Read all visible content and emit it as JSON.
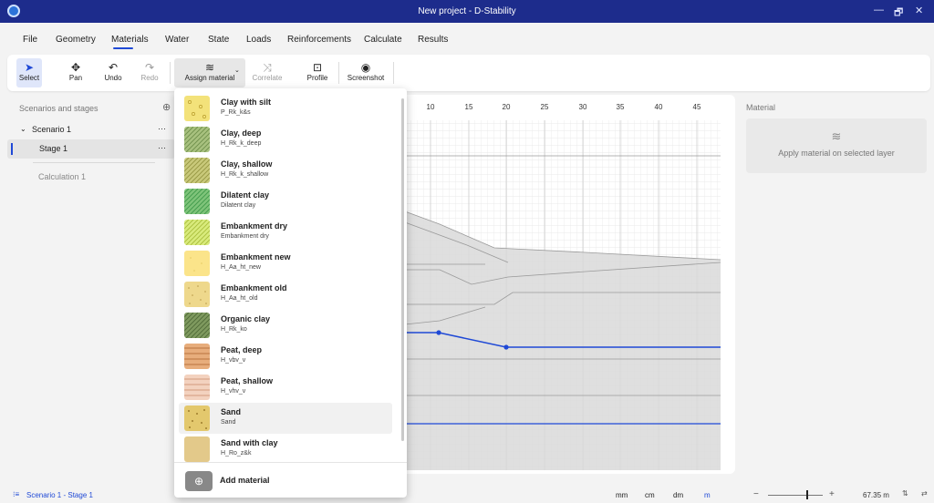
{
  "window": {
    "title": "New project - D-Stability",
    "controls": [
      "—",
      "🗗",
      "✕"
    ]
  },
  "menu": [
    {
      "label": "File"
    },
    {
      "label": "Geometry"
    },
    {
      "label": "Materials"
    },
    {
      "label": "Water"
    },
    {
      "label": "State"
    },
    {
      "label": "Loads"
    },
    {
      "label": "Reinforcements"
    },
    {
      "label": "Calculate"
    },
    {
      "label": "Results"
    }
  ],
  "ribbon": {
    "select": "Select",
    "pan": "Pan",
    "undo": "Undo",
    "redo": "Redo",
    "assign_material": "Assign material",
    "correlate": "Correlate",
    "profile": "Profile",
    "screenshot": "Screenshot"
  },
  "left_panel": {
    "header": "Scenarios and stages",
    "scenario": "Scenario 1",
    "stage": "Stage 1",
    "calculation": "Calculation 1",
    "more": "···"
  },
  "ruler": {
    "ticks": [
      "10",
      "15",
      "20",
      "25",
      "30",
      "35",
      "40",
      "45"
    ]
  },
  "right_panel": {
    "header": "Material",
    "hint": "Apply material on selected layer"
  },
  "material_menu": {
    "items": [
      {
        "name": "Clay with silt",
        "code": "P_Rk_k&s",
        "pattern": "silt"
      },
      {
        "name": "Clay, deep",
        "code": "H_Rk_k_deep",
        "pattern": "diag-green"
      },
      {
        "name": "Clay, shallow",
        "code": "H_Rk_k_shallow",
        "pattern": "diag-olive"
      },
      {
        "name": "Dilatent clay",
        "code": "Dilatent clay",
        "pattern": "diag-bright"
      },
      {
        "name": "Embankment dry",
        "code": "Embankment dry",
        "pattern": "diag-lime"
      },
      {
        "name": "Embankment new",
        "code": "H_Aa_ht_new",
        "pattern": "dots-yellow"
      },
      {
        "name": "Embankment old",
        "code": "H_Aa_ht_old",
        "pattern": "dots-tan"
      },
      {
        "name": "Organic clay",
        "code": "H_Rk_ko",
        "pattern": "diag-dark"
      },
      {
        "name": "Peat, deep",
        "code": "H_vbv_v",
        "pattern": "stripe-orange"
      },
      {
        "name": "Peat, shallow",
        "code": "H_vhv_v",
        "pattern": "stripe-pink"
      },
      {
        "name": "Sand",
        "code": "Sand",
        "pattern": "dots-sand"
      },
      {
        "name": "Sand with clay",
        "code": "H_Ro_z&k",
        "pattern": "plain-sand"
      }
    ],
    "add_label": "Add material",
    "add_icon": "⊕"
  },
  "status": {
    "breadcrumb": "Scenario 1 - Stage 1",
    "units": [
      "mm",
      "cm",
      "dm",
      "m"
    ],
    "active_unit": "m",
    "zoom_minus": "−",
    "zoom_plus": "+",
    "scale": "67.35 m",
    "zoom_level": 0.7
  },
  "colors": {
    "accent": "#1f49d6",
    "titlebar": "#1d2c8c",
    "phreatic": "#1f49d6",
    "soil": "#d9d9d9"
  }
}
